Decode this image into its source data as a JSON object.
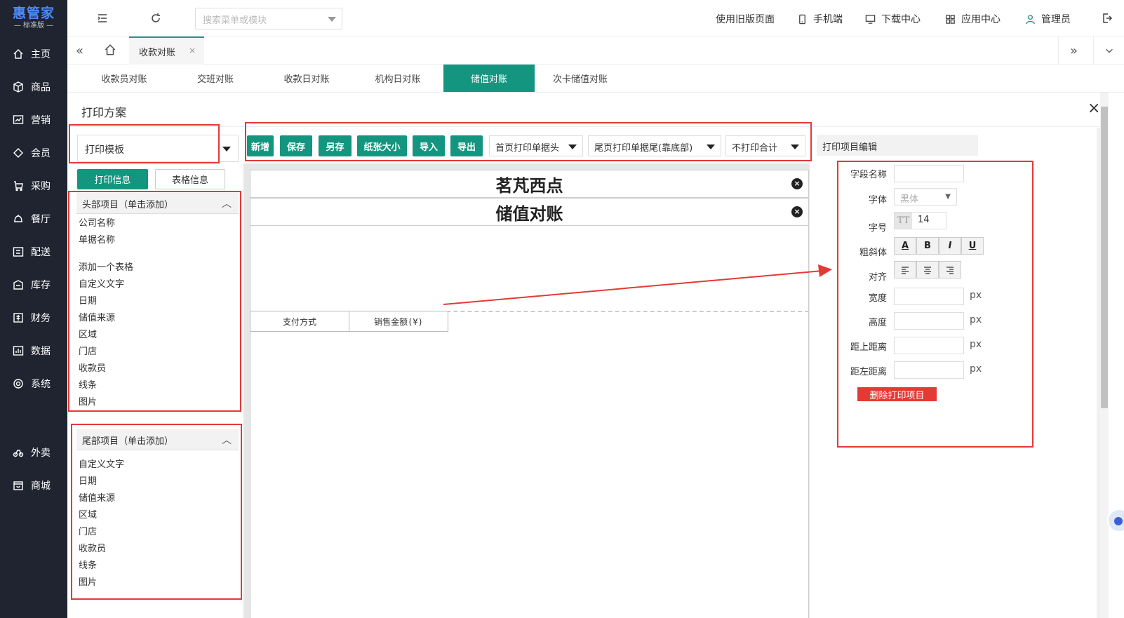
{
  "app": {
    "logo_main": "惠管家",
    "logo_sub": "标准版"
  },
  "sidebar": {
    "items": [
      {
        "label": "主页",
        "icon": "home-icon"
      },
      {
        "label": "商品",
        "icon": "box-icon"
      },
      {
        "label": "营销",
        "icon": "chart-icon"
      },
      {
        "label": "会员",
        "icon": "diamond-icon"
      },
      {
        "label": "采购",
        "icon": "cart-icon"
      },
      {
        "label": "餐厅",
        "icon": "bell-icon"
      },
      {
        "label": "配送",
        "icon": "delivery-icon"
      },
      {
        "label": "库存",
        "icon": "warehouse-icon"
      },
      {
        "label": "财务",
        "icon": "finance-icon"
      },
      {
        "label": "数据",
        "icon": "data-icon"
      },
      {
        "label": "系统",
        "icon": "settings-icon"
      },
      {
        "label": "外卖",
        "icon": "bike-icon"
      },
      {
        "label": "商城",
        "icon": "shop-icon"
      }
    ]
  },
  "topbar": {
    "search_placeholder": "搜索菜单或模块",
    "links": [
      "使用旧版页面",
      "手机端",
      "下载中心",
      "应用中心",
      "管理员"
    ]
  },
  "tabs": {
    "active": "收款对账",
    "close": "×"
  },
  "subtabs": [
    "收款员对账",
    "交班对账",
    "收款日对账",
    "机构日对账",
    "储值对账",
    "次卡储值对账"
  ],
  "panel": {
    "title": "打印方案",
    "close": "×"
  },
  "toolbar": {
    "template_select": "打印模板",
    "buttons": [
      "新增",
      "保存",
      "另存",
      "纸张大小",
      "导入",
      "导出"
    ],
    "selects": [
      "首页打印单据头",
      "尾页打印单据尾(靠底部)",
      "不打印合计"
    ]
  },
  "left": {
    "print_info": "打印信息",
    "table_info": "表格信息",
    "head_section": "头部项目（单击添加）",
    "head_items": [
      "公司名称",
      "单据名称",
      "添加一个表格",
      "自定义文字",
      "日期",
      "储值来源",
      "区域",
      "门店",
      "收款员",
      "线条",
      "图片"
    ],
    "tail_section": "尾部项目（单击添加）",
    "tail_items": [
      "自定义文字",
      "日期",
      "储值来源",
      "区域",
      "门店",
      "收款员",
      "线条",
      "图片"
    ]
  },
  "canvas": {
    "title1": "茗芃西点",
    "title2": "储值对账",
    "col1": "支付方式",
    "col2": "销售金额(¥)"
  },
  "editor": {
    "head": "打印项目编辑",
    "labels": {
      "field": "字段名称",
      "font": "字体",
      "size": "字号",
      "style": "粗斜体",
      "align": "对齐",
      "width": "宽度",
      "height": "高度",
      "top": "距上距离",
      "left": "距左距离"
    },
    "font_value": "黑体",
    "size_value": "14",
    "size_glyph": "TT",
    "unit": "px",
    "style_buttons": [
      "A",
      "B",
      "I",
      "U"
    ],
    "delete": "删除打印项目"
  },
  "colors": {
    "accent": "#14957f",
    "annotation": "#e53935",
    "sidebar": "#1f2430"
  }
}
